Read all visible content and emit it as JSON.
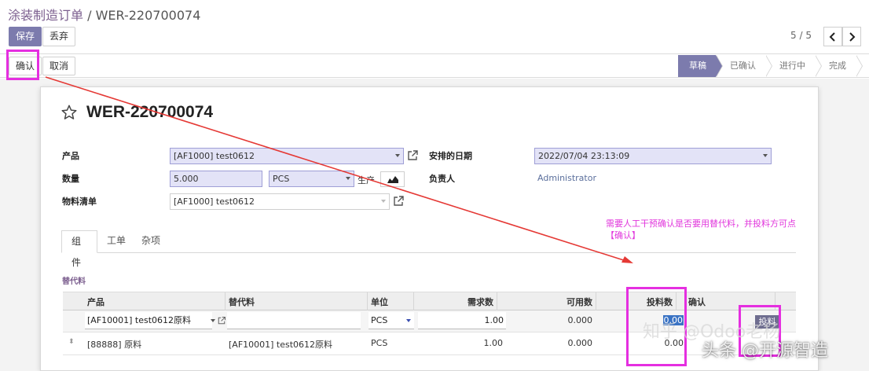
{
  "breadcrumb": {
    "parent": "涂装制造订单",
    "separator": " / ",
    "current": "WER-220700074"
  },
  "toolbar": {
    "save_label": "保存",
    "discard_label": "丢弃"
  },
  "pager": {
    "value": "5 / 5",
    "prev_icon": "chevron-left-icon",
    "next_icon": "chevron-right-icon"
  },
  "actions": {
    "confirm_label": "确认",
    "cancel_label": "取消"
  },
  "stages": [
    "草稿",
    "已确认",
    "进行中",
    "完成"
  ],
  "active_stage": "草稿",
  "record": {
    "title": "WER-220700074",
    "labels": {
      "product": "产品",
      "quantity": "数量",
      "bom": "物料清单",
      "scheduled_date": "安排的日期",
      "responsible": "负责人"
    },
    "product": "[AF1000] test0612",
    "quantity": "5.000",
    "uom": "PCS",
    "produce_label": "生产",
    "bom": "[AF1000] test0612",
    "scheduled_date": "2022/07/04 23:13:09",
    "responsible": "Administrator"
  },
  "annotation": "需要人工干预确认是否要用替代料，并投料方可点【确认】",
  "tabs": [
    "组件",
    "工单",
    "杂项"
  ],
  "section_title": "替代料",
  "table": {
    "headers": [
      "产品",
      "替代料",
      "单位",
      "需求数",
      "可用数",
      "投料数",
      "确认"
    ],
    "rows": [
      {
        "product": "[AF10001] test0612原料",
        "substitute": "",
        "uom": "PCS",
        "required": "1.00",
        "available": "0.000",
        "feed": "0.00",
        "feed_button": "投料"
      },
      {
        "product": "[88888] 原料",
        "substitute": "[AF10001] test0612原料",
        "uom": "PCS",
        "required": "1.00",
        "available": "0.000",
        "feed": "0.00"
      }
    ]
  },
  "watermarks": {
    "zhihu": "知乎 @Odoo老杨",
    "toutiao": "头条 @开源智造"
  },
  "colors": {
    "primary": "#7c7bad",
    "highlight": "#e52fe0",
    "arrow": "#e53935",
    "link": "#7c5f8f"
  }
}
